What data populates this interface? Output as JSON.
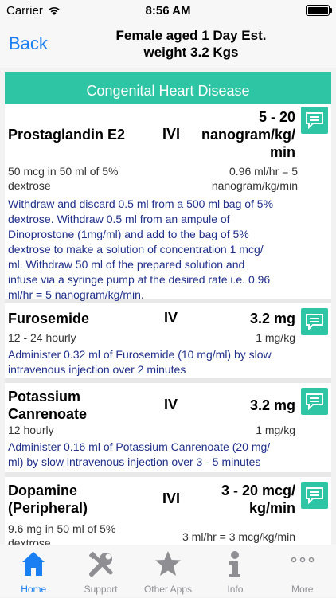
{
  "status": {
    "carrier": "Carrier",
    "time": "8:56 AM"
  },
  "nav": {
    "back_label": "Back",
    "title_line1": "Female aged 1 Day  Est.",
    "title_line2": "weight 3.2 Kgs"
  },
  "section": {
    "title": "Congenital Heart Disease"
  },
  "drugs": [
    {
      "name_line1": "Prostaglandin E2",
      "name_line2": "",
      "route": "IVI",
      "dose_line1": "5 - 20",
      "dose_line2": "nanogram/kg/",
      "dose_line3": "min",
      "dilution_line1": "50 mcg in 50 ml of 5%",
      "dilution_line2": "dextrose",
      "rate_line1": "0.96 ml/hr = 5",
      "rate_line2": "nanogram/kg/min",
      "instructions": [
        "Withdraw and discard 0.5 ml from a 500 ml bag of 5%",
        "dextrose. Withdraw 0.5 ml from an ampule of",
        "Dinoprostone (1mg/ml) and add to the bag of 5%",
        "dextrose to make a solution of concentration 1 mcg/",
        "ml. Withdraw 50 ml of the prepared solution and",
        "infuse via a syringe pump at the desired rate i.e. 0.96",
        "ml/hr = 5 nanogram/kg/min."
      ]
    },
    {
      "name_line1": "Furosemide",
      "name_line2": "",
      "route": "IV",
      "dose_line1": "3.2 mg",
      "dilution_line1": "12 - 24 hourly",
      "rate_line1": "1 mg/kg",
      "instructions": [
        "Administer 0.32 ml of Furosemide (10 mg/ml) by slow",
        "intravenous injection over 2 minutes"
      ]
    },
    {
      "name_line1": "Potassium",
      "name_line2": "Canrenoate",
      "route": "IV",
      "dose_line1": "3.2 mg",
      "dilution_line1": "12 hourly",
      "rate_line1": "1 mg/kg",
      "instructions": [
        "Administer 0.16 ml of Potassium Canrenoate (20 mg/",
        "ml) by slow intravenous injection over 3 - 5 minutes"
      ]
    },
    {
      "name_line1": "Dopamine",
      "name_line2": "(Peripheral)",
      "route": "IVI",
      "dose_line1": "3 - 20 mcg/",
      "dose_line2": "kg/min",
      "dilution_line1": "9.6 mg in 50 ml of 5%",
      "dilution_line2": "dextrose",
      "rate_line1": "3 ml/hr = 3 mcg/kg/min"
    }
  ],
  "tabs": [
    {
      "label": "Home",
      "icon": "home-icon"
    },
    {
      "label": "Support",
      "icon": "tools-icon"
    },
    {
      "label": "Other Apps",
      "icon": "star-icon"
    },
    {
      "label": "Info",
      "icon": "info-icon"
    },
    {
      "label": "More",
      "icon": "more-icon"
    }
  ],
  "colors": {
    "accent": "#1a7ff2",
    "teal": "#2ec5a4",
    "instruction_text": "#1f2f8a"
  }
}
